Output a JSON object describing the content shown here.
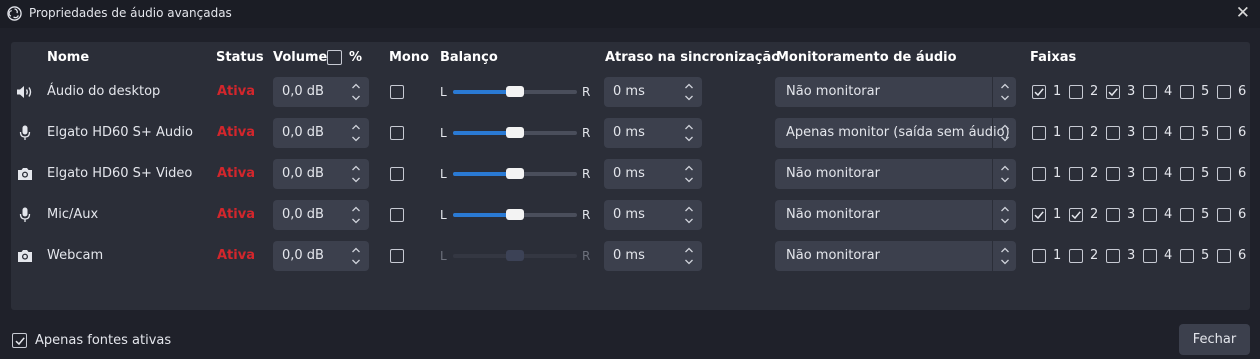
{
  "window": {
    "title": "Propriedades de áudio avançadas",
    "close_label": "✕",
    "icon": "obs-logo-icon"
  },
  "headers": {
    "nome": "Nome",
    "status": "Status",
    "volume": "Volume",
    "percent": "%",
    "mono": "Mono",
    "balanco": "Balanço",
    "atraso": "Atraso na sincronização",
    "monitor": "Monitoramento de áudio",
    "faixas": "Faixas"
  },
  "volume_percent_checked": false,
  "balance_left": "L",
  "balance_right": "R",
  "track_labels": [
    "1",
    "2",
    "3",
    "4",
    "5",
    "6"
  ],
  "rows": [
    {
      "icon": "speaker-icon",
      "name": "Áudio do desktop",
      "status": "Ativa",
      "volume": "0,0 dB",
      "mono": false,
      "balance": 0.5,
      "balance_enabled": true,
      "sync": "0 ms",
      "monitor": "Não monitorar",
      "tracks": [
        true,
        false,
        true,
        false,
        false,
        false
      ]
    },
    {
      "icon": "microphone-icon",
      "name": "Elgato HD60 S+ Audio",
      "status": "Ativa",
      "volume": "0,0 dB",
      "mono": false,
      "balance": 0.5,
      "balance_enabled": true,
      "sync": "0 ms",
      "monitor": "Apenas monitor (saída sem áudio)",
      "tracks": [
        false,
        false,
        false,
        false,
        false,
        false
      ]
    },
    {
      "icon": "camera-icon",
      "name": "Elgato HD60 S+ Video",
      "status": "Ativa",
      "volume": "0,0 dB",
      "mono": false,
      "balance": 0.5,
      "balance_enabled": true,
      "sync": "0 ms",
      "monitor": "Não monitorar",
      "tracks": [
        false,
        false,
        false,
        false,
        false,
        false
      ]
    },
    {
      "icon": "microphone-icon",
      "name": "Mic/Aux",
      "status": "Ativa",
      "volume": "0,0 dB",
      "mono": false,
      "balance": 0.5,
      "balance_enabled": true,
      "sync": "0 ms",
      "monitor": "Não monitorar",
      "tracks": [
        true,
        true,
        false,
        false,
        false,
        false
      ]
    },
    {
      "icon": "camera-icon",
      "name": "Webcam",
      "status": "Ativa",
      "volume": "0,0 dB",
      "mono": false,
      "balance": 0.5,
      "balance_enabled": false,
      "sync": "0 ms",
      "monitor": "Não monitorar",
      "tracks": [
        false,
        false,
        false,
        false,
        false,
        false
      ]
    }
  ],
  "footer": {
    "only_active_label": "Apenas fontes ativas",
    "only_active_checked": true,
    "close_button": "Fechar"
  },
  "colors": {
    "status_active": "#d3262c",
    "accent": "#2a7ad4",
    "panel": "#2b2e38",
    "background": "#1f212a"
  }
}
